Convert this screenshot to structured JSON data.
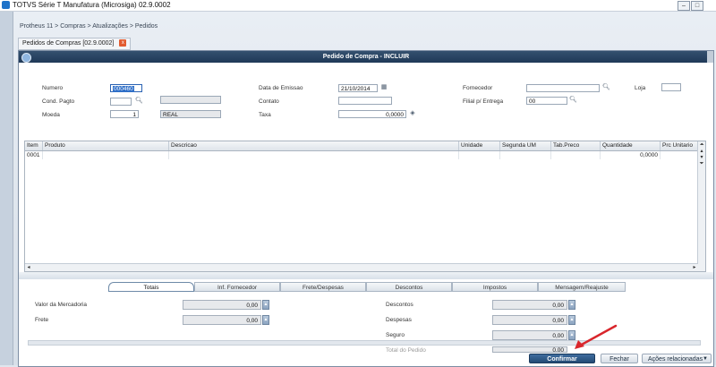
{
  "window": {
    "title": "TOTVS Série T Manufatura (Microsiga) 02.9.0002",
    "buttons": [
      "–",
      "□"
    ]
  },
  "breadcrumb": "Protheus 11 > Compras > Atualizações > Pedidos",
  "tab": {
    "label": "Pedidos de Compras [02.9.0002]",
    "close": "x"
  },
  "dialog": {
    "title": "Pedido de Compra - INCLUIR",
    "form": {
      "numero": {
        "label": "Numero",
        "value": "000460"
      },
      "cond_pagto": {
        "label": "Cond. Pagto",
        "value": "",
        "desc": ""
      },
      "moeda": {
        "label": "Moeda",
        "value": "1",
        "desc": "REAL"
      },
      "data_emissao": {
        "label": "Data de Emissao",
        "value": "21/10/2014"
      },
      "contato": {
        "label": "Contato",
        "value": ""
      },
      "taxa": {
        "label": "Taxa",
        "value": "0,0000"
      },
      "fornecedor": {
        "label": "Fornecedor",
        "value": ""
      },
      "loja": {
        "label": "Loja",
        "value": ""
      },
      "filial_entrega": {
        "label": "Filial p/ Entrega",
        "value": "00"
      }
    },
    "grid": {
      "columns": [
        "Item",
        "Produto",
        "Descricao",
        "Unidade",
        "Segunda UM",
        "Tab.Preco",
        "Quantidade",
        "Prc Unitario"
      ],
      "rows": [
        {
          "item": "0001",
          "produto": "",
          "descricao": "",
          "unidade": "",
          "segunda_um": "",
          "tab_preco": "",
          "quantidade": "0,0000",
          "prc_unitario": ""
        }
      ]
    },
    "tabs": [
      "Totais",
      "Inf. Fornecedor",
      "Frete/Despesas",
      "Descontos",
      "Impostos",
      "Mensagem/Reajuste"
    ],
    "totals": {
      "valor_mercadoria": {
        "label": "Valor da Mercadoria",
        "value": "0,00"
      },
      "frete": {
        "label": "Frete",
        "value": "0,00"
      },
      "descontos": {
        "label": "Descontos",
        "value": "0,00"
      },
      "despesas": {
        "label": "Despesas",
        "value": "0,00"
      },
      "seguro": {
        "label": "Seguro",
        "value": "0,00"
      },
      "total_pedido": {
        "label": "Total do Pedido",
        "value": "0,00"
      }
    },
    "footer": {
      "confirm": "Confirmar",
      "close": "Fechar",
      "actions": "Ações relacionadas"
    },
    "annotation_color": "#d9262c"
  }
}
